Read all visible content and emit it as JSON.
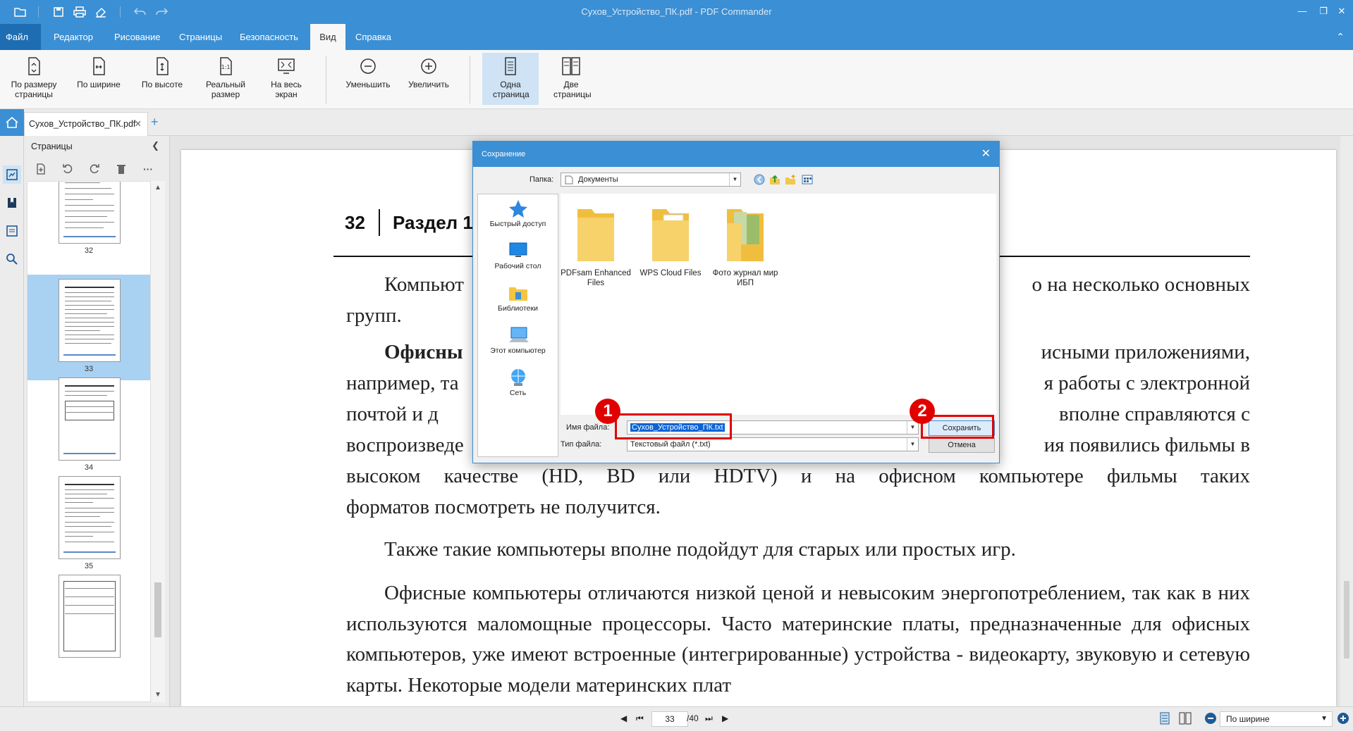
{
  "window": {
    "title": "Сухов_Устройство_ПК.pdf - PDF Commander"
  },
  "menu": {
    "file": "Файл",
    "items": [
      "Редактор",
      "Рисование",
      "Страницы",
      "Безопасность",
      "Вид",
      "Справка"
    ],
    "active": "Вид"
  },
  "ribbon": {
    "fit_page": "По размеру страницы",
    "fit_width": "По ширине",
    "fit_height": "По высоте",
    "actual_size": "Реальный размер",
    "fullscreen": "На весь экран",
    "zoom_out": "Уменьшить",
    "zoom_in": "Увеличить",
    "single_page": "Одна страница",
    "two_pages": "Две страницы"
  },
  "tabs": {
    "document": "Сухов_Устройство_ПК.pdf"
  },
  "pages_panel": {
    "title": "Страницы",
    "thumbnails": [
      {
        "number": "32"
      },
      {
        "number": "33"
      },
      {
        "number": "34"
      },
      {
        "number": "35"
      }
    ]
  },
  "document": {
    "chapter_number": "32",
    "chapter_title": "Раздел 1",
    "p1_start": "Компьют",
    "p1_end": "о на несколько основных",
    "p1_line2": "групп.",
    "p2_bold": "Офисны",
    "p2_end": "исными приложениями,",
    "p2_line2_start": "например, та",
    "p2_line2_end": "я работы с электронной",
    "p2_line3_start": "почтой и д",
    "p2_line3_end": "вполне справляются с",
    "p2_line4_start": "воспроизведе",
    "p2_line4_end": "ия появились фильмы в",
    "p2_line5": "высоком качестве (HD, BD или HDTV) и на офисном компьютере фильмы таких",
    "p2_line6": "форматов посмотреть не получится.",
    "p3": "Также такие компьютеры вполне подойдут для старых или простых игр.",
    "p4": "Офисные компьютеры отличаются низкой ценой и невысоким энергопотреблением, так как в них используются маломощные процессоры. Часто материнские платы, предназначенные для офисных компьютеров, уже имеют встроенные (интегрированные) устройства - видеокарту, звуковую и сетевую карты. Некоторые модели материнских плат"
  },
  "statusbar": {
    "current_page": "33",
    "total_pages": "/40",
    "zoom_mode": "По ширине"
  },
  "dialog": {
    "title": "Сохранение",
    "folder_label": "Папка:",
    "folder_value": "Документы",
    "places": [
      "Быстрый доступ",
      "Рабочий стол",
      "Библиотеки",
      "Этот компьютер",
      "Сеть"
    ],
    "files": [
      {
        "name": "PDFsam Enhanced Files"
      },
      {
        "name": "WPS Cloud Files"
      },
      {
        "name": "Фото журнал мир ИБП"
      }
    ],
    "filename_label": "Имя файла:",
    "filename_value": "Сухов_Устройство_ПК.txt",
    "filetype_label": "Тип файла:",
    "filetype_value": "Текстовый файл (*.txt)",
    "save_button": "Сохранить",
    "cancel_button": "Отмена"
  },
  "annotations": {
    "badge1": "1",
    "badge2": "2",
    "color": "#e00000"
  },
  "colors": {
    "accent": "#3b8fd4",
    "selection": "#a9d1f2"
  }
}
